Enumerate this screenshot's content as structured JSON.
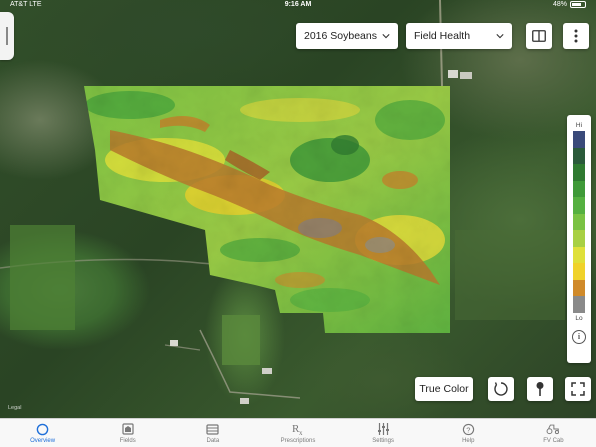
{
  "status_bar": {
    "carrier": "AT&T  LTE",
    "time": "9:16 AM",
    "battery": "48%"
  },
  "toolbar": {
    "season": "2016 Soybeans",
    "layer": "Field Health"
  },
  "legend": {
    "high_label": "Hi",
    "low_label": "Lo",
    "colors": [
      "#3a4a7a",
      "#2a5a3a",
      "#2f7a30",
      "#3f9a38",
      "#55b040",
      "#7ac243",
      "#a8d043",
      "#dfe03a",
      "#f0d22a",
      "#d08a2a",
      "#8a8a8a"
    ],
    "info_icon": "info-icon"
  },
  "map_controls": {
    "true_color_label": "True Color",
    "lasso_icon": "lasso-icon",
    "pin_icon": "pin-icon",
    "fullscreen_icon": "fullscreen-icon"
  },
  "watermark": "Legal",
  "tabs": [
    {
      "label": "Overview",
      "icon": "circle-icon",
      "active": true
    },
    {
      "label": "Fields",
      "icon": "fields-icon",
      "active": false
    },
    {
      "label": "Data",
      "icon": "data-icon",
      "active": false
    },
    {
      "label": "Prescriptions",
      "icon": "rx-icon",
      "active": false
    },
    {
      "label": "Settings",
      "icon": "sliders-icon",
      "active": false
    },
    {
      "label": "Help",
      "icon": "help-icon",
      "active": false
    },
    {
      "label": "FV Cab",
      "icon": "tractor-icon",
      "active": false
    }
  ],
  "colors": {
    "accent": "#1e6fd9"
  }
}
